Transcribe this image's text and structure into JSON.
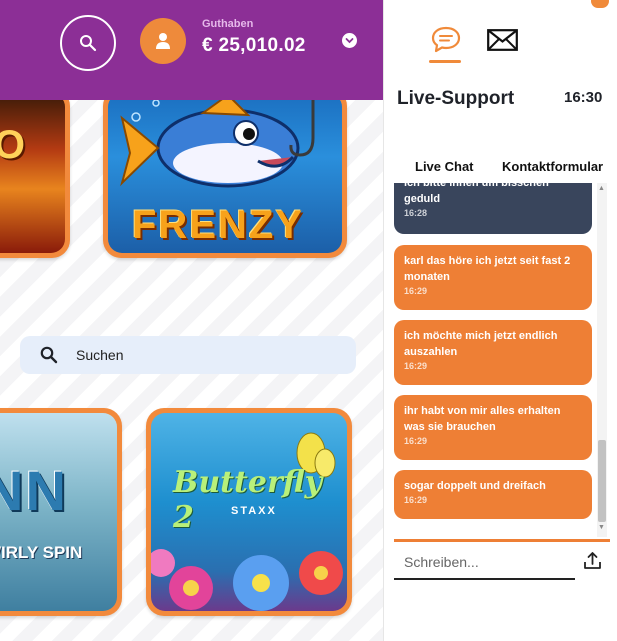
{
  "header": {
    "balance_label": "Guthaben",
    "balance_value": "€ 25,010.02"
  },
  "games": [
    {
      "id": "partial-top-left",
      "title": "RO"
    },
    {
      "id": "fishin-frenzy",
      "title": "FRENZY"
    },
    {
      "id": "finn-swirly-spin",
      "title": "NN",
      "subtitle": "WIRLY SPIN"
    },
    {
      "id": "butterfly-staxx-2",
      "title": "Butterfly 2",
      "subtitle": "STAXX"
    }
  ],
  "search": {
    "placeholder": "Suchen"
  },
  "support": {
    "title": "Live-Support",
    "time": "16:30",
    "tabs": [
      "Live Chat",
      "Kontaktformular"
    ],
    "messages": [
      {
        "sender": "agent",
        "text": "ich bitte ihnen um bisschen geduld",
        "time": "16:28"
      },
      {
        "sender": "user",
        "text": "karl das höre ich jetzt seit fast 2 monaten",
        "time": "16:29"
      },
      {
        "sender": "user",
        "text": "ich möchte mich jetzt endlich auszahlen",
        "time": "16:29"
      },
      {
        "sender": "user",
        "text": "ihr habt von mir alles erhalten was sie brauchen",
        "time": "16:29"
      },
      {
        "sender": "user",
        "text": "sogar doppelt und dreifach",
        "time": "16:29"
      }
    ],
    "composer_placeholder": "Schreiben..."
  },
  "icons": {
    "search": "search-icon",
    "user": "user-icon",
    "chevron": "chevron-down-icon",
    "chat": "chat-bubble-icon",
    "mail": "mail-icon",
    "upload": "upload-icon"
  },
  "colors": {
    "header_purple": "#8c2f96",
    "accent_orange": "#ee7f35",
    "agent_bubble": "#39455c",
    "search_bg": "#e6eefa"
  }
}
